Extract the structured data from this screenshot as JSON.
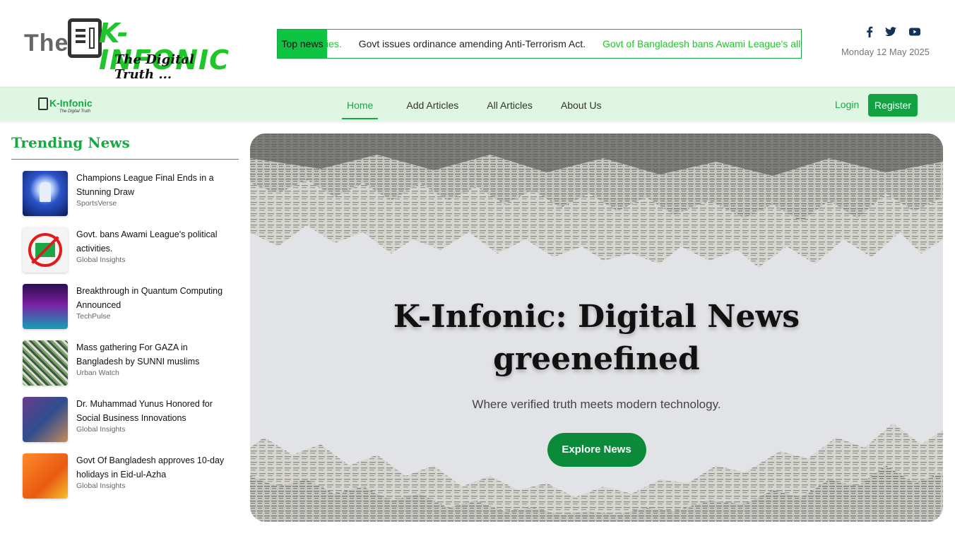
{
  "brand": {
    "prefix": "The",
    "name": "K-INFONIC",
    "tagline": "The Digital Truth ...",
    "nav_name": "K-Infonic",
    "nav_tagline": "The Digital Truth"
  },
  "ticker": {
    "label": "Top news",
    "items": [
      {
        "text": "ities.",
        "tone": "green"
      },
      {
        "text": "Govt issues ordinance amending Anti-Terrorism Act.",
        "tone": "dark"
      },
      {
        "text": "Govt of Bangladesh bans Awami League's all kind of poli",
        "tone": "green"
      }
    ]
  },
  "social": {
    "icons": [
      "facebook-icon",
      "twitter-icon",
      "youtube-icon"
    ]
  },
  "date": "Monday 12 May 2025",
  "nav": {
    "links": [
      {
        "label": "Home",
        "active": true
      },
      {
        "label": "Add Articles",
        "active": false
      },
      {
        "label": "All Articles",
        "active": false
      },
      {
        "label": "About Us",
        "active": false
      }
    ],
    "login": "Login",
    "register": "Register"
  },
  "trending": {
    "title": "Trending News",
    "items": [
      {
        "headline": "Champions League Final Ends in a Stunning Draw",
        "source": "SportsVerse"
      },
      {
        "headline": "Govt. bans Awami League's political activities.",
        "source": "Global Insights"
      },
      {
        "headline": "Breakthrough in Quantum Computing Announced",
        "source": "TechPulse"
      },
      {
        "headline": "Mass gathering For GAZA in Bangladesh by SUNNI muslims",
        "source": "Urban Watch"
      },
      {
        "headline": "Dr. Muhammad Yunus Honored for Social Business Innovations",
        "source": "Global Insights"
      },
      {
        "headline": "Govt Of Bangladesh approves 10-day holidays in Eid-ul-Azha",
        "source": "Global Insights"
      }
    ]
  },
  "hero": {
    "title_line1": "K-Infonic: Digital News",
    "title_line2": "greenefined",
    "subtitle": "Where verified truth meets modern technology.",
    "button": "Explore News"
  },
  "colors": {
    "accent": "#1aa845",
    "nav_bg": "#dff6e2",
    "button": "#0b8a3a"
  }
}
